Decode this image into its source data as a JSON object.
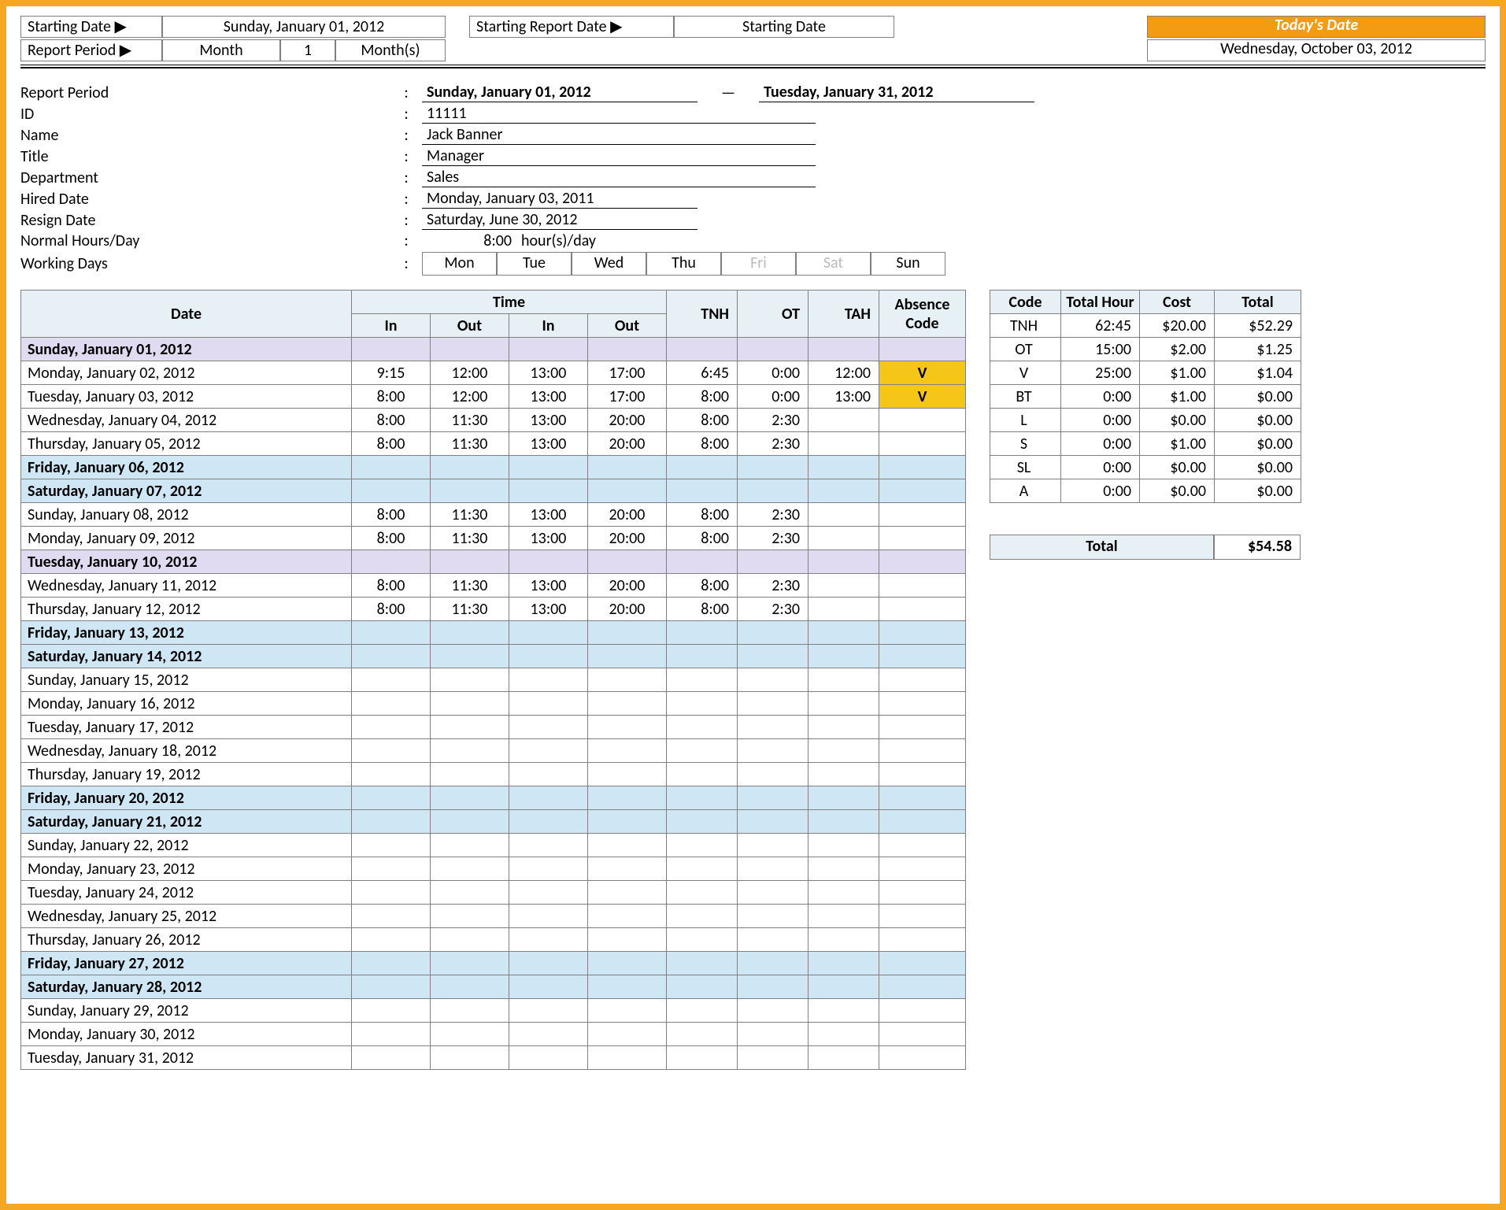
{
  "top": {
    "starting_date_label": "Starting Date ▶",
    "starting_date": "Sunday, January 01, 2012",
    "report_period_label": "Report Period ▶",
    "period_unit": "Month",
    "period_count": "1",
    "period_suffix": "Month(s)",
    "starting_report_date_label": "Starting Report Date ▶",
    "starting_report_date": "Starting Date",
    "todays_date_label": "Today's Date",
    "todays_date": "Wednesday, October 03, 2012"
  },
  "info": {
    "report_period_label": "Report Period",
    "report_period_from": "Sunday, January 01, 2012",
    "report_period_sep": "—",
    "report_period_to": "Tuesday, January 31, 2012",
    "id_label": "ID",
    "id": "11111",
    "name_label": "Name",
    "name": "Jack Banner",
    "title_label": "Title",
    "title": "Manager",
    "dept_label": "Department",
    "dept": "Sales",
    "hired_label": "Hired Date",
    "hired": "Monday, January 03, 2011",
    "resign_label": "Resign Date",
    "resign": "Saturday, June 30, 2012",
    "hours_label": "Normal Hours/Day",
    "hours": "8:00",
    "hours_suffix": "hour(s)/day",
    "wd_label": "Working Days",
    "days": [
      "Mon",
      "Tue",
      "Wed",
      "Thu",
      "Fri",
      "Sat",
      "Sun"
    ],
    "days_off": [
      false,
      false,
      false,
      false,
      true,
      true,
      false
    ]
  },
  "timesheet": {
    "headers": {
      "date": "Date",
      "time": "Time",
      "in": "In",
      "out": "Out",
      "tnh": "TNH",
      "ot": "OT",
      "tah": "TAH",
      "absence": "Absence Code"
    },
    "rows": [
      {
        "date": "Sunday, January 01, 2012",
        "type": "holiday"
      },
      {
        "date": "Monday, January 02, 2012",
        "in1": "9:15",
        "out1": "12:00",
        "in2": "13:00",
        "out2": "17:00",
        "tnh": "6:45",
        "ot": "0:00",
        "tah": "12:00",
        "abs": "V"
      },
      {
        "date": "Tuesday, January 03, 2012",
        "in1": "8:00",
        "out1": "12:00",
        "in2": "13:00",
        "out2": "17:00",
        "tnh": "8:00",
        "ot": "0:00",
        "tah": "13:00",
        "abs": "V"
      },
      {
        "date": "Wednesday, January 04, 2012",
        "in1": "8:00",
        "out1": "11:30",
        "in2": "13:00",
        "out2": "20:00",
        "tnh": "8:00",
        "ot": "2:30"
      },
      {
        "date": "Thursday, January 05, 2012",
        "in1": "8:00",
        "out1": "11:30",
        "in2": "13:00",
        "out2": "20:00",
        "tnh": "8:00",
        "ot": "2:30"
      },
      {
        "date": "Friday, January 06, 2012",
        "type": "weekend"
      },
      {
        "date": "Saturday, January 07, 2012",
        "type": "weekend"
      },
      {
        "date": "Sunday, January 08, 2012",
        "in1": "8:00",
        "out1": "11:30",
        "in2": "13:00",
        "out2": "20:00",
        "tnh": "8:00",
        "ot": "2:30"
      },
      {
        "date": "Monday, January 09, 2012",
        "in1": "8:00",
        "out1": "11:30",
        "in2": "13:00",
        "out2": "20:00",
        "tnh": "8:00",
        "ot": "2:30"
      },
      {
        "date": "Tuesday, January 10, 2012",
        "type": "holiday"
      },
      {
        "date": "Wednesday, January 11, 2012",
        "in1": "8:00",
        "out1": "11:30",
        "in2": "13:00",
        "out2": "20:00",
        "tnh": "8:00",
        "ot": "2:30"
      },
      {
        "date": "Thursday, January 12, 2012",
        "in1": "8:00",
        "out1": "11:30",
        "in2": "13:00",
        "out2": "20:00",
        "tnh": "8:00",
        "ot": "2:30"
      },
      {
        "date": "Friday, January 13, 2012",
        "type": "weekend"
      },
      {
        "date": "Saturday, January 14, 2012",
        "type": "weekend"
      },
      {
        "date": "Sunday, January 15, 2012"
      },
      {
        "date": "Monday, January 16, 2012"
      },
      {
        "date": "Tuesday, January 17, 2012"
      },
      {
        "date": "Wednesday, January 18, 2012"
      },
      {
        "date": "Thursday, January 19, 2012"
      },
      {
        "date": "Friday, January 20, 2012",
        "type": "weekend"
      },
      {
        "date": "Saturday, January 21, 2012",
        "type": "weekend"
      },
      {
        "date": "Sunday, January 22, 2012"
      },
      {
        "date": "Monday, January 23, 2012"
      },
      {
        "date": "Tuesday, January 24, 2012"
      },
      {
        "date": "Wednesday, January 25, 2012"
      },
      {
        "date": "Thursday, January 26, 2012"
      },
      {
        "date": "Friday, January 27, 2012",
        "type": "weekend"
      },
      {
        "date": "Saturday, January 28, 2012",
        "type": "weekend"
      },
      {
        "date": "Sunday, January 29, 2012"
      },
      {
        "date": "Monday, January 30, 2012"
      },
      {
        "date": "Tuesday, January 31, 2012"
      }
    ]
  },
  "codes": {
    "headers": {
      "code": "Code",
      "hour": "Total Hour",
      "cost": "Cost",
      "total": "Total"
    },
    "rows": [
      {
        "code": "TNH",
        "hour": "62:45",
        "cost": "$20.00",
        "total": "$52.29"
      },
      {
        "code": "OT",
        "hour": "15:00",
        "cost": "$2.00",
        "total": "$1.25"
      },
      {
        "code": "V",
        "hour": "25:00",
        "cost": "$1.00",
        "total": "$1.04"
      },
      {
        "code": "BT",
        "hour": "0:00",
        "cost": "$1.00",
        "total": "$0.00"
      },
      {
        "code": "L",
        "hour": "0:00",
        "cost": "$0.00",
        "total": "$0.00"
      },
      {
        "code": "S",
        "hour": "0:00",
        "cost": "$1.00",
        "total": "$0.00"
      },
      {
        "code": "SL",
        "hour": "0:00",
        "cost": "$0.00",
        "total": "$0.00"
      },
      {
        "code": "A",
        "hour": "0:00",
        "cost": "$0.00",
        "total": "$0.00"
      }
    ],
    "grand_label": "Total",
    "grand_total": "$54.58"
  }
}
